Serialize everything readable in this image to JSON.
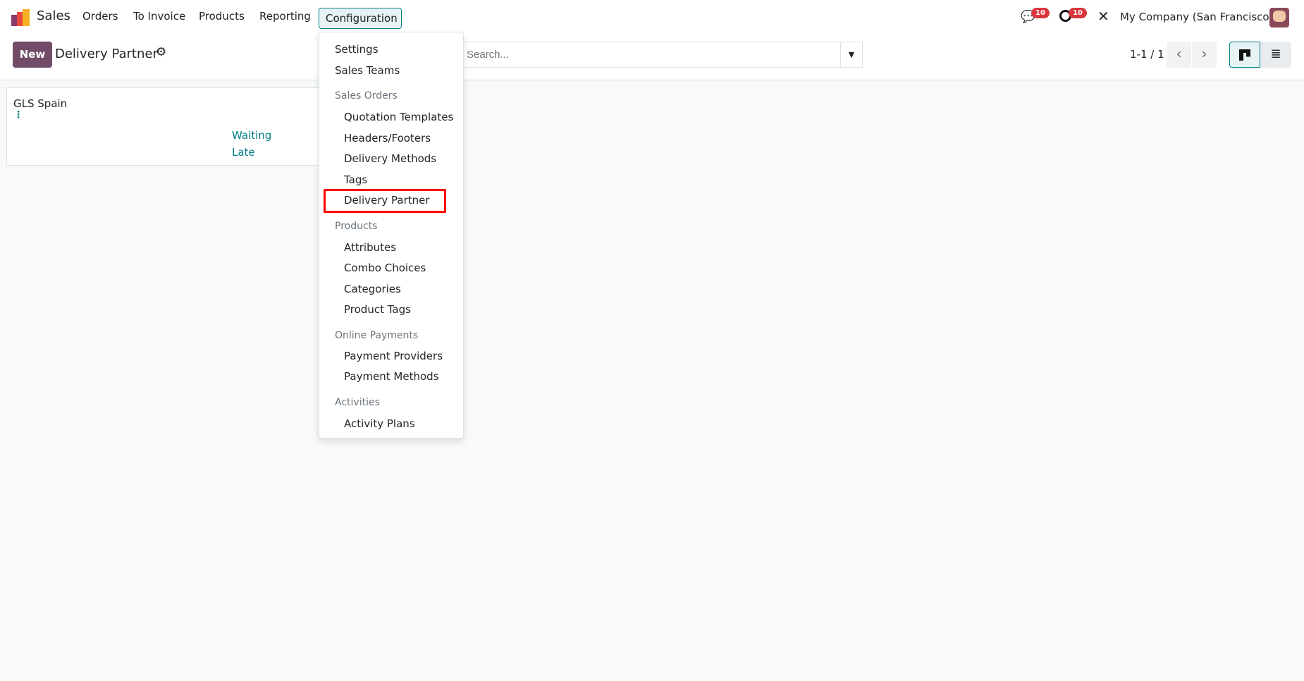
{
  "navbar": {
    "app": "Sales",
    "items": [
      "Orders",
      "To Invoice",
      "Products",
      "Reporting",
      "Configuration"
    ],
    "chat_count": "10",
    "activity_count": "10",
    "company": "My Company (San Francisco)"
  },
  "control": {
    "new_label": "New",
    "title": "Delivery Partner",
    "search_placeholder": "Search...",
    "pager": "1-1 / 1"
  },
  "card": {
    "name": "GLS Spain",
    "status1": "Waiting",
    "status2": "Late"
  },
  "menu": {
    "settings": "Settings",
    "sales_teams": "Sales Teams",
    "sections": [
      {
        "header": "Sales Orders",
        "items": [
          "Quotation Templates",
          "Headers/Footers",
          "Delivery Methods",
          "Tags",
          "Delivery Partner"
        ]
      },
      {
        "header": "Products",
        "items": [
          "Attributes",
          "Combo Choices",
          "Categories",
          "Product Tags"
        ]
      },
      {
        "header": "Online Payments",
        "items": [
          "Payment Providers",
          "Payment Methods"
        ]
      },
      {
        "header": "Activities",
        "items": [
          "Activity Plans"
        ]
      }
    ]
  },
  "colors": {
    "brand": "#714b67",
    "accent": "#017e84",
    "badge": "#d9363e",
    "highlight": "#ff0000"
  }
}
